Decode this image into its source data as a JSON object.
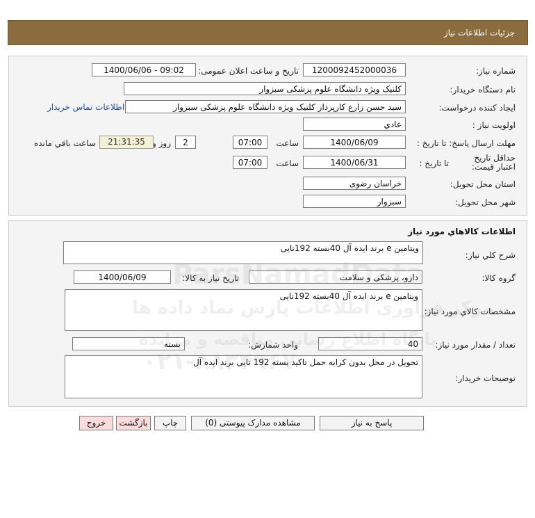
{
  "header": {
    "title": "جزئیات اطلاعات نیاز"
  },
  "info": {
    "need_number_label": "شماره نیاز:",
    "need_number": "1200092452000036",
    "announce_label": "تاریخ و ساعت اعلان عمومی:",
    "announce_value": "1400/06/06 - 09:02",
    "buyer_org_label": "نام دستگاه خریدار:",
    "buyer_org": "کلنیک ویژه    دانشگاه علوم پزشکی سبزوار",
    "requester_label": "ایجاد کننده درخواست:",
    "requester": "سید حسن زارع کارپرداز کلنیک ویژه    دانشگاه علوم پزشکی سبزوار",
    "contact_link": "اطلاعات تماس خریدار",
    "priority_label": "اولویت نیاز :",
    "priority": "عادي",
    "deadline_label": "مهلت ارسال پاسخ:  تا تاریخ :",
    "deadline_date": "1400/06/09",
    "time_label": "ساعت",
    "deadline_time": "07:00",
    "days_value": "2",
    "days_label": "روز و",
    "remaining_time": "21:31:35",
    "remaining_label": "ساعت باقي مانده",
    "validity_label": "حداقل تاریخ اعتبار قیمت:",
    "validity_to_label": "تا تاریخ :",
    "validity_date": "1400/06/31",
    "validity_time": "07:00",
    "province_label": "استان محل تحویل:",
    "province": "خراسان رضوی",
    "city_label": "شهر محل تحویل:",
    "city": "سبزوار"
  },
  "goods": {
    "section_title": "اطلاعات کالاهاي مورد نياز",
    "summary_label": "شرح کلي نياز:",
    "summary": "ویتامین e برند ایده آل 40بسته 192تایی",
    "group_label": "گروه کالا:",
    "group": "دارو، پزشکی و سلامت",
    "need_date_label": "تاریخ نیاز به کالا:",
    "need_date": "1400/06/09",
    "spec_label": "مشخصات کالاي مورد نياز:",
    "spec": "ویتامین e برند ایده آل 40بسته 192تایی",
    "qty_label": "تعداد / مقدار مورد نیاز:",
    "qty": "40",
    "unit_label": "واحد شمارش:",
    "unit": "بسته",
    "notes_label": "توضيحات خريدار:",
    "notes": "تحویل در محل بدون کرایه حمل تاکید بسته 192 تایی برند ایده آل"
  },
  "buttons": {
    "reply": "پاسخ به نیاز",
    "attachments": "مشاهده مدارک پیوستی (0)",
    "print": "چاپ",
    "back": "بازگشت",
    "exit": "خروج"
  },
  "watermark": {
    "brand": "ParsNamadData",
    "line1": "مرکز فراوری اطلاعات پارس نماد داده ها",
    "line2": "پایگاه اطلاع رسانی مناقصه و مزایده",
    "phone": "۰۲۱-۸۸۳۴۹۶۷۰"
  }
}
